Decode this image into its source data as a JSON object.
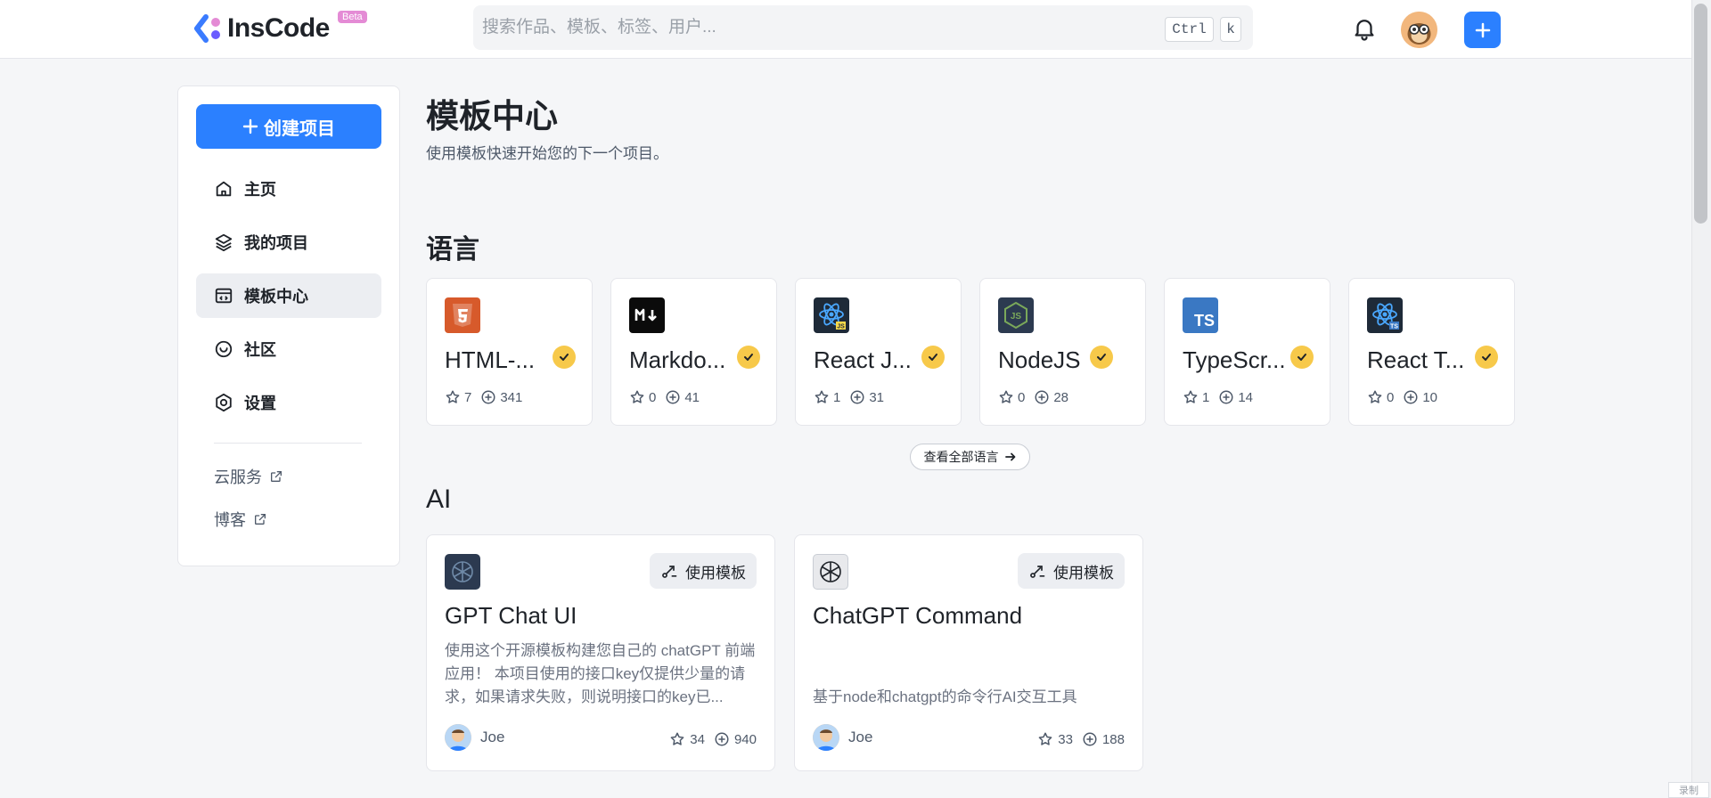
{
  "header": {
    "logo_text": "InsCode",
    "logo_badge": "Beta",
    "search_placeholder": "搜索作品、模板、标签、用户...",
    "kbd_ctrl": "Ctrl",
    "kbd_k": "k"
  },
  "sidebar": {
    "create_label": "创建项目",
    "items": [
      {
        "label": "主页",
        "icon": "home-icon"
      },
      {
        "label": "我的项目",
        "icon": "layers-icon"
      },
      {
        "label": "模板中心",
        "icon": "template-icon",
        "active": true
      },
      {
        "label": "社区",
        "icon": "community-icon"
      },
      {
        "label": "设置",
        "icon": "settings-icon"
      }
    ],
    "links": [
      {
        "label": "云服务",
        "icon": "external-link-icon"
      },
      {
        "label": "博客",
        "icon": "external-link-icon"
      }
    ]
  },
  "main": {
    "title": "模板中心",
    "subtitle": "使用模板快速开始您的下一个项目。",
    "language_section": {
      "title": "语言",
      "view_all": "查看全部语言",
      "cards": [
        {
          "name": "HTML-...",
          "stars": "7",
          "forks": "341",
          "icon": "html5-icon",
          "color": "#d75a2b"
        },
        {
          "name": "Markdo...",
          "stars": "0",
          "forks": "41",
          "icon": "markdown-icon",
          "color": "#0b0b0b"
        },
        {
          "name": "React J...",
          "stars": "1",
          "forks": "31",
          "icon": "react-js-icon",
          "color": "#1e2a38"
        },
        {
          "name": "NodeJS",
          "stars": "0",
          "forks": "28",
          "icon": "nodejs-icon",
          "color": "#2c3a50"
        },
        {
          "name": "TypeScr...",
          "stars": "1",
          "forks": "14",
          "icon": "typescript-icon",
          "color": "#3a78c3",
          "icon_text": "TS"
        },
        {
          "name": "React T...",
          "stars": "0",
          "forks": "10",
          "icon": "react-ts-icon",
          "color": "#1e2a38"
        }
      ]
    },
    "ai_section": {
      "title": "AI",
      "use_template_label": "使用模板",
      "cards": [
        {
          "name": "GPT Chat UI",
          "description": "使用这个开源模板构建您自己的 chatGPT 前端应用！ 本项目使用的接口key仅提供少量的请求，如果请求失败，则说明接口的key已...",
          "author": "Joe",
          "stars": "34",
          "forks": "940",
          "icon": "openai-icon"
        },
        {
          "name": "ChatGPT Command",
          "description": "基于node和chatgpt的命令行AI交互工具",
          "author": "Joe",
          "stars": "33",
          "forks": "188",
          "icon": "openai-icon"
        }
      ]
    }
  },
  "corner_tag": "录制"
}
